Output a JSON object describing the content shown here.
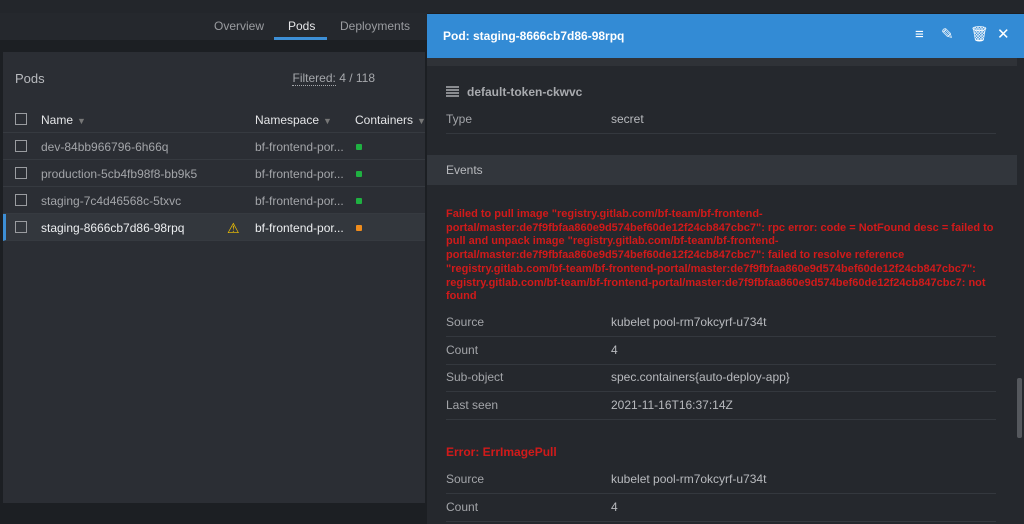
{
  "tabs": [
    "Overview",
    "Pods",
    "Deployments"
  ],
  "pods": {
    "title": "Pods",
    "filtered_label": "Filtered:",
    "filtered_value": "4 / 118",
    "columns": [
      "Name",
      "Namespace",
      "Containers"
    ],
    "rows": [
      {
        "name": "dev-84bb966796-6h66q",
        "namespace": "bf-frontend-por...",
        "status_color": "#1fb141"
      },
      {
        "name": "production-5cb4fb98f8-bb9k5",
        "namespace": "bf-frontend-por...",
        "status_color": "#1fb141"
      },
      {
        "name": "staging-7c4d46568c-5txvc",
        "namespace": "bf-frontend-por...",
        "status_color": "#1fb141"
      },
      {
        "name": "staging-8666cb7d86-98rpq",
        "namespace": "bf-frontend-por...",
        "status_color": "#f08c1c",
        "warning": "⚠"
      }
    ]
  },
  "drawer": {
    "title": "Pod: staging-8666cb7d86-98rpq",
    "icons": [
      "list-icon",
      "edit-icon",
      "delete-icon",
      "close-icon"
    ],
    "secret_name": "default-token-ckwvc",
    "secret_type_label": "Type",
    "secret_type_value": "secret",
    "events_title": "Events",
    "event1": {
      "message": "Failed to pull image \"registry.gitlab.com/bf-team/bf-frontend-portal/master:de7f9fbfaa860e9d574bef60de12f24cb847cbc7\": rpc error: code = NotFound desc = failed to pull and unpack image \"registry.gitlab.com/bf-team/bf-frontend-portal/master:de7f9fbfaa860e9d574bef60de12f24cb847cbc7\": failed to resolve reference \"registry.gitlab.com/bf-team/bf-frontend-portal/master:de7f9fbfaa860e9d574bef60de12f24cb847cbc7\": registry.gitlab.com/bf-team/bf-frontend-portal/master:de7f9fbfaa860e9d574bef60de12f24cb847cbc7: not found",
      "fields": [
        [
          "Source",
          "kubelet pool-rm7okcyrf-u734t"
        ],
        [
          "Count",
          "4"
        ],
        [
          "Sub-object",
          "spec.containers{auto-deploy-app}"
        ],
        [
          "Last seen",
          "2021-11-16T16:37:14Z"
        ]
      ]
    },
    "event2": {
      "message": "Error: ErrImagePull",
      "fields": [
        [
          "Source",
          "kubelet pool-rm7okcyrf-u734t"
        ],
        [
          "Count",
          "4"
        ]
      ]
    }
  }
}
